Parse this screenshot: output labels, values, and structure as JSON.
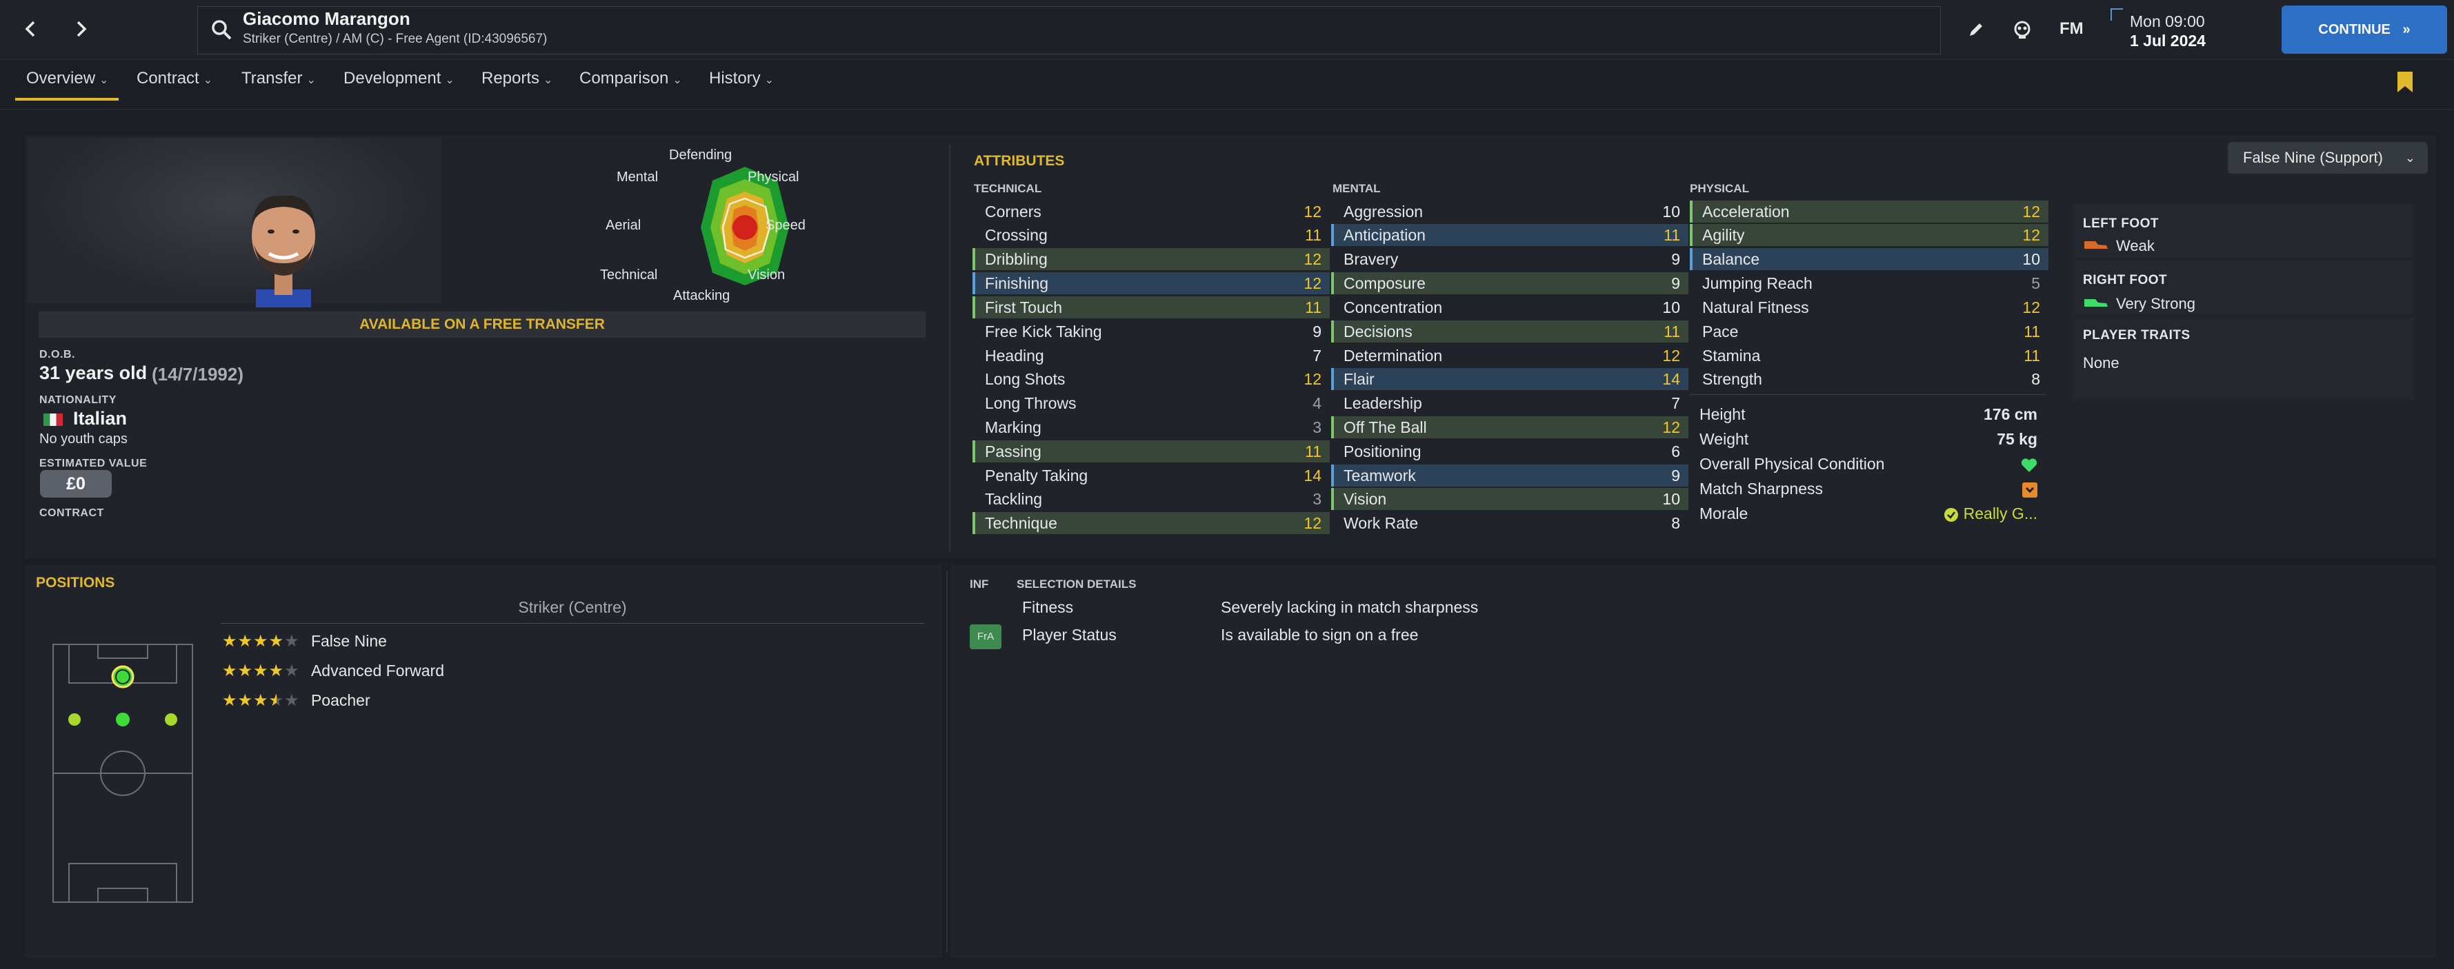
{
  "header": {
    "player_name": "Giacomo Marangon",
    "player_subtitle": "Striker (Centre) / AM (C) - Free Agent (ID:43096567)",
    "fm_label": "FM",
    "time": "Mon 09:00",
    "date": "1 Jul 2024",
    "continue_label": "CONTINUE"
  },
  "tabs": [
    "Overview",
    "Contract",
    "Transfer",
    "Development",
    "Reports",
    "Comparison",
    "History"
  ],
  "radar": {
    "labels": {
      "top": "Defending",
      "top_right": "Physical",
      "right": "Speed",
      "bottom_right": "Vision",
      "bottom": "Attacking",
      "bottom_left": "Technical",
      "left": "Aerial",
      "top_left": "Mental"
    }
  },
  "profile": {
    "free_transfer_label": "AVAILABLE ON A FREE TRANSFER",
    "dob_label": "D.O.B.",
    "age": "31 years old",
    "dob": "(14/7/1992)",
    "nationality_label": "NATIONALITY",
    "nationality": "Italian",
    "youth_caps": "No youth caps",
    "value_label": "ESTIMATED VALUE",
    "value": "£0",
    "contract_label": "CONTRACT"
  },
  "attributes": {
    "title": "ATTRIBUTES",
    "role": "False Nine (Support)",
    "technical_label": "TECHNICAL",
    "mental_label": "MENTAL",
    "physical_label": "PHYSICAL",
    "technical": [
      {
        "name": "Corners",
        "value": "12"
      },
      {
        "name": "Crossing",
        "value": "11"
      },
      {
        "name": "Dribbling",
        "value": "12"
      },
      {
        "name": "Finishing",
        "value": "12"
      },
      {
        "name": "First Touch",
        "value": "11"
      },
      {
        "name": "Free Kick Taking",
        "value": "9"
      },
      {
        "name": "Heading",
        "value": "7"
      },
      {
        "name": "Long Shots",
        "value": "12"
      },
      {
        "name": "Long Throws",
        "value": "4"
      },
      {
        "name": "Marking",
        "value": "3"
      },
      {
        "name": "Passing",
        "value": "11"
      },
      {
        "name": "Penalty Taking",
        "value": "14"
      },
      {
        "name": "Tackling",
        "value": "3"
      },
      {
        "name": "Technique",
        "value": "12"
      }
    ],
    "mental": [
      {
        "name": "Aggression",
        "value": "10"
      },
      {
        "name": "Anticipation",
        "value": "11"
      },
      {
        "name": "Bravery",
        "value": "9"
      },
      {
        "name": "Composure",
        "value": "9"
      },
      {
        "name": "Concentration",
        "value": "10"
      },
      {
        "name": "Decisions",
        "value": "11"
      },
      {
        "name": "Determination",
        "value": "12"
      },
      {
        "name": "Flair",
        "value": "14"
      },
      {
        "name": "Leadership",
        "value": "7"
      },
      {
        "name": "Off The Ball",
        "value": "12"
      },
      {
        "name": "Positioning",
        "value": "6"
      },
      {
        "name": "Teamwork",
        "value": "9"
      },
      {
        "name": "Vision",
        "value": "10"
      },
      {
        "name": "Work Rate",
        "value": "8"
      }
    ],
    "physical": [
      {
        "name": "Acceleration",
        "value": "12"
      },
      {
        "name": "Agility",
        "value": "12"
      },
      {
        "name": "Balance",
        "value": "10"
      },
      {
        "name": "Jumping Reach",
        "value": "5"
      },
      {
        "name": "Natural Fitness",
        "value": "12"
      },
      {
        "name": "Pace",
        "value": "11"
      },
      {
        "name": "Stamina",
        "value": "11"
      },
      {
        "name": "Strength",
        "value": "8"
      }
    ],
    "height_label": "Height",
    "height": "176 cm",
    "weight_label": "Weight",
    "weight": "75 kg",
    "condition_label": "Overall Physical Condition",
    "sharpness_label": "Match Sharpness",
    "morale_label": "Morale",
    "morale": "Really G..."
  },
  "feet": {
    "left_label": "LEFT FOOT",
    "left": "Weak",
    "right_label": "RIGHT FOOT",
    "right": "Very Strong",
    "traits_label": "PLAYER TRAITS",
    "traits": "None"
  },
  "positions": {
    "title": "POSITIONS",
    "main": "Striker (Centre)",
    "roles": [
      {
        "name": "False Nine",
        "stars": 4
      },
      {
        "name": "Advanced Forward",
        "stars": 4
      },
      {
        "name": "Poacher",
        "stars": 3.5
      }
    ]
  },
  "selection": {
    "inf_label": "INF",
    "header": "SELECTION DETAILS",
    "rows": [
      {
        "inf": "",
        "label": "Fitness",
        "value": "Severely lacking in match sharpness"
      },
      {
        "inf": "FrA",
        "label": "Player Status",
        "value": "Is available to sign on a free"
      }
    ]
  }
}
